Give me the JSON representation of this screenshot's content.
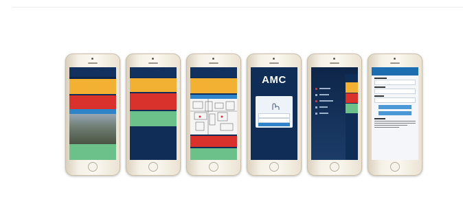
{
  "image": {
    "description_hidden": false
  },
  "app": {
    "logo_text": "AMC"
  },
  "colors": {
    "navy": "#0f2d57",
    "orange": "#f3b134",
    "red": "#d9312c",
    "green": "#6cc18a",
    "blue": "#2f83c9",
    "light": "#eef3f9"
  },
  "icons": {
    "camera": "camera-icon",
    "speaker": "speaker-icon",
    "home_button": "home-button-icon",
    "logo": "amc-logo"
  }
}
